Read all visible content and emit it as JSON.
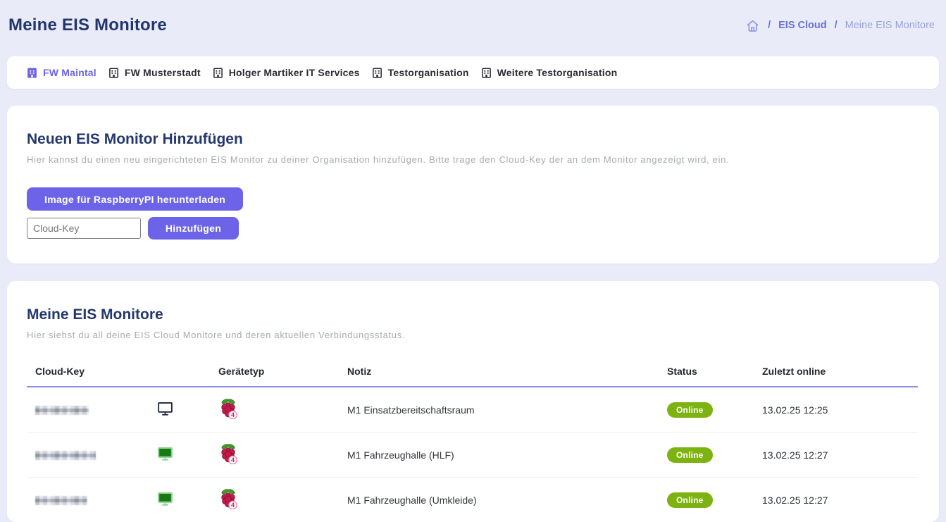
{
  "page": {
    "title": "Meine EIS Monitore"
  },
  "breadcrumb": {
    "separator": "/",
    "items": [
      {
        "label": "EIS Cloud"
      },
      {
        "label": "Meine EIS Monitore"
      }
    ]
  },
  "org_tabs": [
    {
      "label": "FW Maintal",
      "active": true
    },
    {
      "label": "FW Musterstadt",
      "active": false
    },
    {
      "label": "Holger Martiker IT Services",
      "active": false
    },
    {
      "label": "Testorganisation",
      "active": false
    },
    {
      "label": "Weitere Testorganisation",
      "active": false
    }
  ],
  "add_monitor_card": {
    "title": "Neuen EIS Monitor Hinzufügen",
    "subtitle": "Hier kannst du einen neu eingerichteten EIS Monitor zu deiner Organisation hinzufügen. Bitte trage den Cloud-Key der an dem Monitor angezeigt wird, ein.",
    "download_button": "Image für RaspberryPI herunterladen",
    "cloud_key_placeholder": "Cloud-Key",
    "add_button": "Hinzufügen"
  },
  "monitors_card": {
    "title": "Meine EIS Monitore",
    "subtitle": "Hier siehst du all deine EIS Cloud Monitore und deren aktuellen Verbindungsstatus.",
    "table": {
      "headers": [
        "Cloud-Key",
        "",
        "Gerätetyp",
        "Notiz",
        "Status",
        "Zuletzt online"
      ],
      "rows": [
        {
          "cloud_key_censored": true,
          "screen_on": false,
          "device": "Raspberry Pi",
          "device_badge": "4",
          "note": "M1 Einsatzbereitschaftsraum",
          "status": "Online",
          "last_online": "13.02.25 12:25"
        },
        {
          "cloud_key_censored": true,
          "screen_on": true,
          "device": "Raspberry Pi",
          "device_badge": "4",
          "note": "M1 Fahrzeughalle (HLF)",
          "status": "Online",
          "last_online": "13.02.25 12:27"
        },
        {
          "cloud_key_censored": true,
          "screen_on": true,
          "device": "Raspberry Pi",
          "device_badge": "4",
          "note": "M1 Fahrzeughalle (Umkleide)",
          "status": "Online",
          "last_online": "13.02.25 12:27"
        }
      ]
    }
  },
  "icons": {
    "breadcrumb_home": "home-icon",
    "org_tab": "building-icon",
    "screen_off": "monitor-outline-icon",
    "screen_on": "monitor-green-icon",
    "device": "raspberry-pi-icon"
  },
  "colors": {
    "page_background": "#e9ecf8",
    "accent_purple": "#6c63e8",
    "title_navy": "#22356e",
    "breadcrumb_muted": "#9aa2d8",
    "status_online_bg": "#7cb310",
    "table_header_rule": "#8d92e0"
  }
}
